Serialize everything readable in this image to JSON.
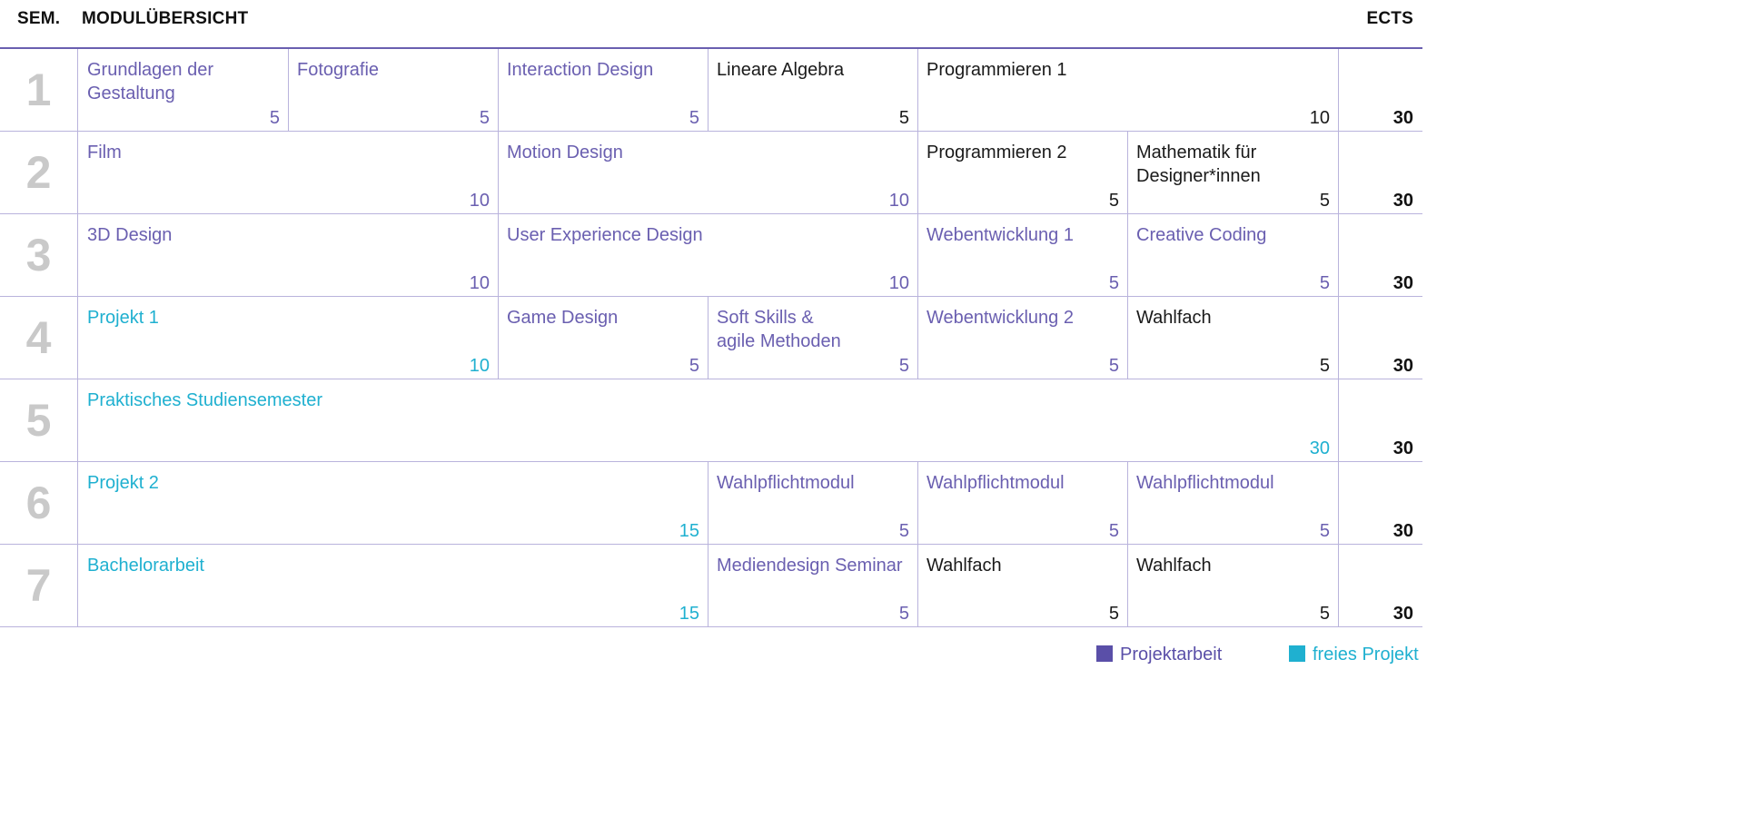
{
  "header": {
    "sem_label": "SEM.",
    "title": "MODULÜBERSICHT",
    "ects_label": "ECTS"
  },
  "colors": {
    "purple": "#6a5fb0",
    "black": "#1a1a1a",
    "cyan": "#1fb0d0",
    "grid": "#b9b3dc"
  },
  "semesters": [
    {
      "num": "1",
      "total": "30",
      "modules": [
        {
          "name": "Grundlagen der\nGestaltung",
          "ects": "5",
          "type": "purple"
        },
        {
          "name": "Fotografie",
          "ects": "5",
          "type": "purple"
        },
        {
          "name": "Interaction Design",
          "ects": "5",
          "type": "purple"
        },
        {
          "name": "Lineare Algebra",
          "ects": "5",
          "type": "black"
        },
        {
          "name": "Programmieren 1",
          "ects": "10",
          "type": "black"
        }
      ]
    },
    {
      "num": "2",
      "total": "30",
      "modules": [
        {
          "name": "Film",
          "ects": "10",
          "type": "purple"
        },
        {
          "name": "Motion Design",
          "ects": "10",
          "type": "purple"
        },
        {
          "name": "Programmieren 2",
          "ects": "5",
          "type": "black"
        },
        {
          "name": "Mathematik für\nDesigner*innen",
          "ects": "5",
          "type": "black"
        }
      ]
    },
    {
      "num": "3",
      "total": "30",
      "modules": [
        {
          "name": "3D Design",
          "ects": "10",
          "type": "purple"
        },
        {
          "name": "User Experience Design",
          "ects": "10",
          "type": "purple"
        },
        {
          "name": "Webentwicklung 1",
          "ects": "5",
          "type": "purple"
        },
        {
          "name": "Creative Coding",
          "ects": "5",
          "type": "purple"
        }
      ]
    },
    {
      "num": "4",
      "total": "30",
      "modules": [
        {
          "name": "Projekt 1",
          "ects": "10",
          "type": "cyan"
        },
        {
          "name": "Game Design",
          "ects": "5",
          "type": "purple"
        },
        {
          "name": "Soft Skills &\nagile Methoden",
          "ects": "5",
          "type": "purple"
        },
        {
          "name": "Webentwicklung 2",
          "ects": "5",
          "type": "purple"
        },
        {
          "name": "Wahlfach",
          "ects": "5",
          "type": "black"
        }
      ]
    },
    {
      "num": "5",
      "total": "30",
      "modules": [
        {
          "name": "Praktisches Studiensemester",
          "ects": "30",
          "type": "cyan"
        }
      ]
    },
    {
      "num": "6",
      "total": "30",
      "modules": [
        {
          "name": "Projekt 2",
          "ects": "15",
          "type": "cyan"
        },
        {
          "name": "Wahlpflichtmodul",
          "ects": "5",
          "type": "purple"
        },
        {
          "name": "Wahlpflichtmodul",
          "ects": "5",
          "type": "purple"
        },
        {
          "name": "Wahlpflichtmodul",
          "ects": "5",
          "type": "purple"
        }
      ]
    },
    {
      "num": "7",
      "total": "30",
      "modules": [
        {
          "name": "Bachelorarbeit",
          "ects": "15",
          "type": "cyan"
        },
        {
          "name": "Mediendesign Seminar",
          "ects": "5",
          "type": "purple"
        },
        {
          "name": "Wahlfach",
          "ects": "5",
          "type": "black"
        },
        {
          "name": "Wahlfach",
          "ects": "5",
          "type": "black"
        }
      ]
    }
  ],
  "legend": {
    "project_work": "Projektarbeit",
    "free_project": "freies Projekt"
  }
}
